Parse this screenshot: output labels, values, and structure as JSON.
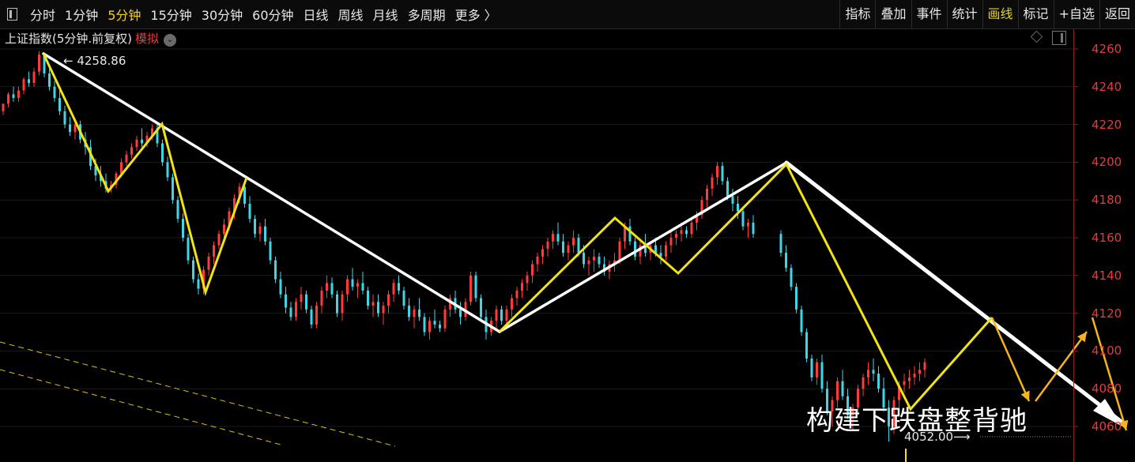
{
  "toolbar": {
    "periods": [
      "分时",
      "1分钟",
      "5分钟",
      "15分钟",
      "30分钟",
      "60分钟",
      "日线",
      "周线",
      "月线",
      "多周期",
      "更多 〉"
    ],
    "active_period": "5分钟",
    "tools": [
      "指标",
      "叠加",
      "事件",
      "统计",
      "画线",
      "标记",
      "+自选",
      "返回"
    ],
    "active_tool": "画线"
  },
  "header": {
    "title": "上证指数(5分钟.前复权)",
    "mode": "模拟"
  },
  "chart_data": {
    "type": "candlestick",
    "y_ticks": [
      "4260",
      "4240",
      "4220",
      "4200",
      "4180",
      "4160",
      "4140",
      "4120",
      "4100",
      "4080",
      "4060"
    ],
    "ylim": [
      4047,
      4272
    ],
    "high_label": "4258.86",
    "low_label": "4052.00",
    "annotation": "构建下跌盘整背驰",
    "colors": {
      "up": "#ff3b3b",
      "down": "#3fd6e8",
      "axis": "#e83b3b",
      "zigzag": "#f2e312",
      "trend": "#ffffff",
      "arrows": "#f5b51b",
      "dashed": "#d8c21a"
    },
    "candles": [
      [
        4227,
        4231,
        4225,
        4231
      ],
      [
        4231,
        4237,
        4229,
        4236
      ],
      [
        4236,
        4240,
        4232,
        4234
      ],
      [
        4234,
        4240,
        4232,
        4238
      ],
      [
        4238,
        4245,
        4236,
        4244
      ],
      [
        4244,
        4248,
        4240,
        4242
      ],
      [
        4242,
        4250,
        4240,
        4248
      ],
      [
        4248,
        4258.86,
        4246,
        4257
      ],
      [
        4257,
        4258,
        4245,
        4247
      ],
      [
        4247,
        4250,
        4238,
        4240
      ],
      [
        4240,
        4243,
        4232,
        4234
      ],
      [
        4234,
        4238,
        4225,
        4227
      ],
      [
        4227,
        4230,
        4218,
        4220
      ],
      [
        4220,
        4224,
        4214,
        4216
      ],
      [
        4216,
        4222,
        4212,
        4220
      ],
      [
        4220,
        4222,
        4210,
        4212
      ],
      [
        4212,
        4216,
        4204,
        4208
      ],
      [
        4208,
        4212,
        4196,
        4198
      ],
      [
        4198,
        4202,
        4190,
        4193
      ],
      [
        4193,
        4198,
        4187,
        4190
      ],
      [
        4190,
        4194,
        4184,
        4186
      ],
      [
        4186,
        4190,
        4184,
        4188
      ],
      [
        4188,
        4195,
        4186,
        4194
      ],
      [
        4194,
        4202,
        4192,
        4200
      ],
      [
        4200,
        4206,
        4198,
        4204
      ],
      [
        4204,
        4210,
        4202,
        4208
      ],
      [
        4208,
        4214,
        4206,
        4212
      ],
      [
        4212,
        4218,
        4208,
        4210
      ],
      [
        4210,
        4216,
        4208,
        4214
      ],
      [
        4214,
        4220,
        4212,
        4218
      ],
      [
        4218,
        4220,
        4208,
        4210
      ],
      [
        4210,
        4212,
        4198,
        4200
      ],
      [
        4200,
        4203,
        4190,
        4192
      ],
      [
        4192,
        4194,
        4178,
        4180
      ],
      [
        4180,
        4182,
        4168,
        4170
      ],
      [
        4170,
        4173,
        4158,
        4160
      ],
      [
        4160,
        4162,
        4146,
        4148
      ],
      [
        4148,
        4150,
        4136,
        4138
      ],
      [
        4138,
        4141,
        4130,
        4133
      ],
      [
        4133,
        4145,
        4130,
        4143
      ],
      [
        4143,
        4152,
        4140,
        4150
      ],
      [
        4150,
        4158,
        4146,
        4156
      ],
      [
        4156,
        4164,
        4154,
        4162
      ],
      [
        4162,
        4170,
        4158,
        4167
      ],
      [
        4167,
        4176,
        4164,
        4174
      ],
      [
        4174,
        4183,
        4170,
        4181
      ],
      [
        4181,
        4189,
        4178,
        4187
      ],
      [
        4187,
        4190,
        4176,
        4178
      ],
      [
        4178,
        4182,
        4168,
        4170
      ],
      [
        4170,
        4172,
        4160,
        4162
      ],
      [
        4162,
        4168,
        4158,
        4166
      ],
      [
        4166,
        4170,
        4156,
        4158
      ],
      [
        4158,
        4160,
        4146,
        4148
      ],
      [
        4148,
        4150,
        4136,
        4138
      ],
      [
        4138,
        4142,
        4128,
        4130
      ],
      [
        4130,
        4134,
        4120,
        4123
      ],
      [
        4123,
        4126,
        4116,
        4118
      ],
      [
        4118,
        4128,
        4116,
        4126
      ],
      [
        4126,
        4134,
        4122,
        4130
      ],
      [
        4130,
        4132,
        4120,
        4122
      ],
      [
        4122,
        4124,
        4112,
        4114
      ],
      [
        4114,
        4126,
        4112,
        4124
      ],
      [
        4124,
        4134,
        4120,
        4132
      ],
      [
        4132,
        4140,
        4128,
        4136
      ],
      [
        4136,
        4139,
        4128,
        4130
      ],
      [
        4130,
        4132,
        4118,
        4120
      ],
      [
        4120,
        4132,
        4116,
        4130
      ],
      [
        4130,
        4140,
        4126,
        4138
      ],
      [
        4138,
        4144,
        4132,
        4134
      ],
      [
        4134,
        4138,
        4128,
        4136
      ],
      [
        4136,
        4142,
        4130,
        4132
      ],
      [
        4132,
        4134,
        4122,
        4124
      ],
      [
        4124,
        4130,
        4118,
        4126
      ],
      [
        4126,
        4130,
        4118,
        4120
      ],
      [
        4120,
        4126,
        4114,
        4124
      ],
      [
        4124,
        4132,
        4120,
        4130
      ],
      [
        4130,
        4138,
        4126,
        4136
      ],
      [
        4136,
        4140,
        4130,
        4132
      ],
      [
        4132,
        4134,
        4122,
        4124
      ],
      [
        4124,
        4128,
        4116,
        4118
      ],
      [
        4118,
        4124,
        4112,
        4122
      ],
      [
        4122,
        4128,
        4116,
        4118
      ],
      [
        4118,
        4120,
        4108,
        4110
      ],
      [
        4110,
        4118,
        4106,
        4116
      ],
      [
        4116,
        4122,
        4112,
        4114
      ],
      [
        4114,
        4116,
        4110,
        4112
      ],
      [
        4112,
        4124,
        4110,
        4122
      ],
      [
        4122,
        4130,
        4118,
        4128
      ],
      [
        4128,
        4132,
        4120,
        4122
      ],
      [
        4122,
        4126,
        4114,
        4118
      ],
      [
        4118,
        4128,
        4116,
        4126
      ],
      [
        4126,
        4142,
        4124,
        4140
      ],
      [
        4140,
        4142,
        4126,
        4128
      ],
      [
        4128,
        4130,
        4116,
        4118
      ],
      [
        4118,
        4122,
        4106,
        4110
      ],
      [
        4110,
        4118,
        4108,
        4116
      ],
      [
        4116,
        4124,
        4112,
        4122
      ],
      [
        4122,
        4124,
        4114,
        4116
      ],
      [
        4116,
        4124,
        4114,
        4122
      ],
      [
        4122,
        4130,
        4118,
        4128
      ],
      [
        4128,
        4134,
        4124,
        4132
      ],
      [
        4132,
        4138,
        4128,
        4136
      ],
      [
        4136,
        4142,
        4132,
        4140
      ],
      [
        4140,
        4148,
        4136,
        4146
      ],
      [
        4146,
        4152,
        4142,
        4150
      ],
      [
        4150,
        4156,
        4146,
        4154
      ],
      [
        4154,
        4160,
        4150,
        4158
      ],
      [
        4158,
        4164,
        4154,
        4162
      ],
      [
        4162,
        4168,
        4156,
        4158
      ],
      [
        4158,
        4162,
        4150,
        4152
      ],
      [
        4152,
        4158,
        4148,
        4156
      ],
      [
        4156,
        4164,
        4152,
        4160
      ],
      [
        4160,
        4162,
        4150,
        4152
      ],
      [
        4152,
        4156,
        4144,
        4146
      ],
      [
        4146,
        4150,
        4140,
        4148
      ],
      [
        4148,
        4154,
        4142,
        4150
      ],
      [
        4150,
        4152,
        4144,
        4146
      ],
      [
        4146,
        4150,
        4140,
        4142
      ],
      [
        4142,
        4148,
        4138,
        4146
      ],
      [
        4146,
        4152,
        4142,
        4148
      ],
      [
        4148,
        4160,
        4146,
        4158
      ],
      [
        4158,
        4168,
        4154,
        4166
      ],
      [
        4166,
        4170,
        4156,
        4158
      ],
      [
        4158,
        4160,
        4148,
        4150
      ],
      [
        4150,
        4158,
        4146,
        4156
      ],
      [
        4156,
        4162,
        4150,
        4152
      ],
      [
        4152,
        4158,
        4148,
        4156
      ],
      [
        4156,
        4160,
        4150,
        4152
      ],
      [
        4152,
        4156,
        4146,
        4150
      ],
      [
        4150,
        4158,
        4148,
        4156
      ],
      [
        4156,
        4164,
        4152,
        4160
      ],
      [
        4160,
        4164,
        4156,
        4162
      ],
      [
        4162,
        4168,
        4158,
        4164
      ],
      [
        4164,
        4166,
        4160,
        4162
      ],
      [
        4162,
        4170,
        4160,
        4168
      ],
      [
        4168,
        4174,
        4164,
        4172
      ],
      [
        4172,
        4182,
        4170,
        4180
      ],
      [
        4180,
        4188,
        4176,
        4186
      ],
      [
        4186,
        4194,
        4182,
        4192
      ],
      [
        4192,
        4200,
        4188,
        4198
      ],
      [
        4198,
        4200,
        4188,
        4190
      ],
      [
        4190,
        4192,
        4180,
        4182
      ],
      [
        4182,
        4186,
        4174,
        4178
      ],
      [
        4178,
        4182,
        4170,
        4174
      ],
      [
        4174,
        4176,
        4164,
        4166
      ],
      [
        4166,
        4170,
        4160,
        4168
      ],
      [
        4168,
        4172,
        4160,
        4162
      ],
      [
        4162,
        4164,
        4150,
        4152
      ],
      [
        4152,
        4156,
        4142,
        4144
      ],
      [
        4144,
        4146,
        4132,
        4134
      ],
      [
        4134,
        4136,
        4120,
        4122
      ],
      [
        4122,
        4124,
        4108,
        4110
      ],
      [
        4110,
        4112,
        4094,
        4096
      ],
      [
        4096,
        4098,
        4084,
        4086
      ],
      [
        4086,
        4096,
        4082,
        4094
      ],
      [
        4094,
        4098,
        4078,
        4080
      ],
      [
        4080,
        4084,
        4066,
        4068
      ],
      [
        4068,
        4076,
        4060,
        4074
      ],
      [
        4074,
        4086,
        4070,
        4084
      ],
      [
        4084,
        4090,
        4074,
        4076
      ],
      [
        4076,
        4080,
        4064,
        4066
      ],
      [
        4066,
        4072,
        4058,
        4070
      ],
      [
        4070,
        4082,
        4066,
        4080
      ],
      [
        4080,
        4088,
        4076,
        4086
      ],
      [
        4086,
        4094,
        4082,
        4090
      ],
      [
        4090,
        4096,
        4084,
        4088
      ],
      [
        4088,
        4092,
        4078,
        4080
      ],
      [
        4080,
        4086,
        4068,
        4070
      ],
      [
        4070,
        4074,
        4052,
        4060
      ],
      [
        4060,
        4076,
        4056,
        4074
      ],
      [
        4074,
        4084,
        4070,
        4082
      ],
      [
        4082,
        4088,
        4078,
        4084
      ],
      [
        4084,
        4090,
        4080,
        4086
      ],
      [
        4086,
        4092,
        4082,
        4088
      ],
      [
        4088,
        4094,
        4084,
        4090
      ],
      [
        4090,
        4096,
        4086,
        4094
      ]
    ]
  }
}
